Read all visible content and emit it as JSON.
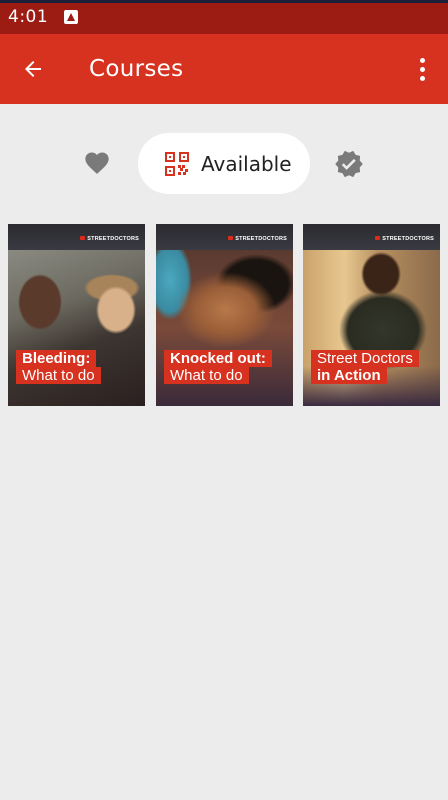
{
  "status_bar": {
    "time": "4:01"
  },
  "app_bar": {
    "title": "Courses"
  },
  "filters": {
    "available_label": "Available"
  },
  "colors": {
    "primary": "#d7311f",
    "status_bar": "#9c1c14",
    "background": "#ececec",
    "icon_gray": "#7a7a7a"
  },
  "courses": [
    {
      "line1": "Bleeding:",
      "line2": "What to do",
      "logo": "STREETDOCTORS"
    },
    {
      "line1": "Knocked out:",
      "line2": "What to do",
      "logo": "STREETDOCTORS"
    },
    {
      "line1": "Street Doctors",
      "line2": "in Action",
      "logo": "STREETDOCTORS"
    }
  ]
}
